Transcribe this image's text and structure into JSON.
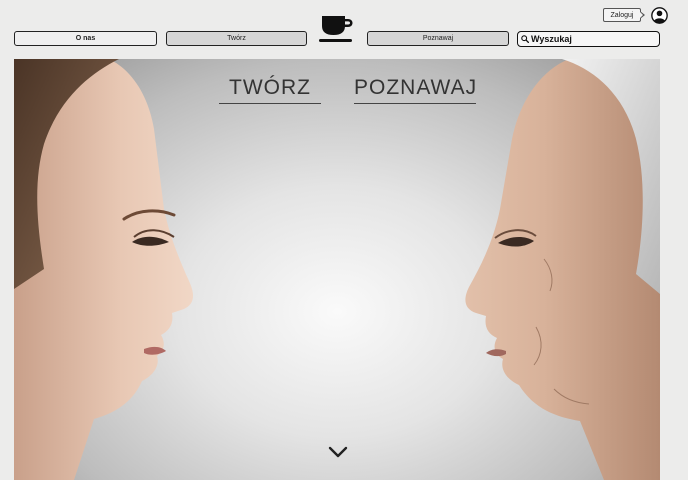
{
  "header": {
    "login_label": "Zaloguj",
    "nav": {
      "o_nas": "O nas",
      "tworz": "Twórz",
      "poznawaj": "Poznawaj"
    },
    "search": {
      "placeholder": "Wyszukaj"
    }
  },
  "hero": {
    "link_tworz": "TWÓRZ",
    "link_poznawaj": "POZNAWAJ"
  },
  "icons": {
    "logo": "coffee-cup-icon",
    "user": "user-avatar-icon",
    "search": "search-icon",
    "scroll": "chevron-down-icon"
  }
}
